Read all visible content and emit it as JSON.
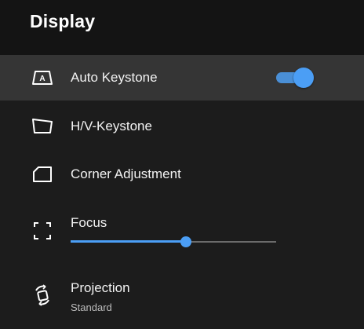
{
  "header": {
    "title": "Display"
  },
  "items": [
    {
      "label": "Auto Keystone",
      "icon": "auto-keystone-icon",
      "selected": true,
      "toggle_on": true
    },
    {
      "label": "H/V-Keystone",
      "icon": "hv-keystone-icon"
    },
    {
      "label": "Corner Adjustment",
      "icon": "corner-adjustment-icon"
    },
    {
      "label": "Focus",
      "icon": "focus-icon",
      "slider_value": 0.56
    },
    {
      "label": "Projection",
      "value": "Standard",
      "icon": "projection-icon"
    }
  ],
  "colors": {
    "accent": "#4b9ef5",
    "background": "#1c1c1c",
    "header_background": "#141414",
    "selected_row": "#353535"
  }
}
